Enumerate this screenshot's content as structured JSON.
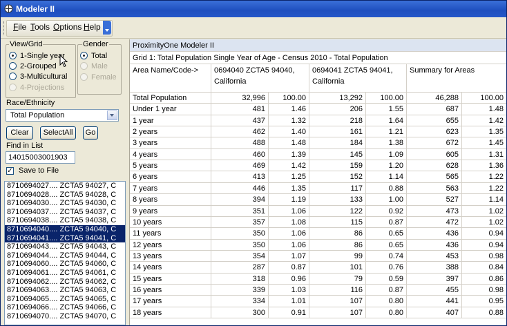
{
  "window": {
    "title": "Modeler II"
  },
  "menu": {
    "items": [
      "File",
      "Tools",
      "Options",
      "Help"
    ]
  },
  "view_grid": {
    "title": "View/Grid",
    "options": [
      "1-Single year",
      "2-Grouped",
      "3-Multicultural",
      "4-Projections"
    ],
    "selected": 0
  },
  "gender": {
    "title": "Gender",
    "options": [
      "Total",
      "Male",
      "Female"
    ],
    "selected": 0
  },
  "race": {
    "label": "Race/Ethnicity",
    "value": "Total Population"
  },
  "buttons": {
    "clear": "Clear",
    "select_all": "SelectAll",
    "go": "Go"
  },
  "find": {
    "label": "Find in List",
    "value": "14015003001903"
  },
  "save": {
    "label": "Save to File",
    "checked": true
  },
  "list_items": [
    "8710694027.... ZCTA5 94027, C",
    "8710694028.... ZCTA5 94028, C",
    "8710694030.... ZCTA5 94030, C",
    "8710694037.... ZCTA5 94037, C",
    "8710694038.... ZCTA5 94038, C",
    "8710694040.... ZCTA5 94040, C",
    "8710694041.... ZCTA5 94041, C",
    "8710694043.... ZCTA5 94043, C",
    "8710694044.... ZCTA5 94044, C",
    "8710694060.... ZCTA5 94060, C",
    "8710694061.... ZCTA5 94061, C",
    "8710694062.... ZCTA5 94062, C",
    "8710694063.... ZCTA5 94063, C",
    "8710694065.... ZCTA5 94065, C",
    "8710694066.... ZCTA5 94066, C",
    "8710694070.... ZCTA5 94070, C"
  ],
  "selected_list_items": [
    5,
    6
  ],
  "grid": {
    "app_title": "ProximityOne Modeler II",
    "grid_title": "Grid 1: Total Population Single Year of Age - Census 2010 -  Total Population",
    "header": {
      "name": "Area Name/Code->",
      "col1": "0694040 ZCTA5 94040, California",
      "col2": "0694041 ZCTA5 94041, California",
      "col3": "Summary for Areas"
    },
    "rows": [
      [
        "Total Population",
        "32,996",
        "100.00",
        "13,292",
        "100.00",
        "46,288",
        "100.00"
      ],
      [
        "Under 1 year",
        "481",
        "1.46",
        "206",
        "1.55",
        "687",
        "1.48"
      ],
      [
        "1 year",
        "437",
        "1.32",
        "218",
        "1.64",
        "655",
        "1.42"
      ],
      [
        "2 years",
        "462",
        "1.40",
        "161",
        "1.21",
        "623",
        "1.35"
      ],
      [
        "3 years",
        "488",
        "1.48",
        "184",
        "1.38",
        "672",
        "1.45"
      ],
      [
        "4 years",
        "460",
        "1.39",
        "145",
        "1.09",
        "605",
        "1.31"
      ],
      [
        "5 years",
        "469",
        "1.42",
        "159",
        "1.20",
        "628",
        "1.36"
      ],
      [
        "6 years",
        "413",
        "1.25",
        "152",
        "1.14",
        "565",
        "1.22"
      ],
      [
        "7 years",
        "446",
        "1.35",
        "117",
        "0.88",
        "563",
        "1.22"
      ],
      [
        "8 years",
        "394",
        "1.19",
        "133",
        "1.00",
        "527",
        "1.14"
      ],
      [
        "9 years",
        "351",
        "1.06",
        "122",
        "0.92",
        "473",
        "1.02"
      ],
      [
        "10 years",
        "357",
        "1.08",
        "115",
        "0.87",
        "472",
        "1.02"
      ],
      [
        "11 years",
        "350",
        "1.06",
        "86",
        "0.65",
        "436",
        "0.94"
      ],
      [
        "12 years",
        "350",
        "1.06",
        "86",
        "0.65",
        "436",
        "0.94"
      ],
      [
        "13 years",
        "354",
        "1.07",
        "99",
        "0.74",
        "453",
        "0.98"
      ],
      [
        "14 years",
        "287",
        "0.87",
        "101",
        "0.76",
        "388",
        "0.84"
      ],
      [
        "15 years",
        "318",
        "0.96",
        "79",
        "0.59",
        "397",
        "0.86"
      ],
      [
        "16 years",
        "339",
        "1.03",
        "116",
        "0.87",
        "455",
        "0.98"
      ],
      [
        "17 years",
        "334",
        "1.01",
        "107",
        "0.80",
        "441",
        "0.95"
      ],
      [
        "18 years",
        "300",
        "0.91",
        "107",
        "0.80",
        "407",
        "0.88"
      ]
    ]
  }
}
